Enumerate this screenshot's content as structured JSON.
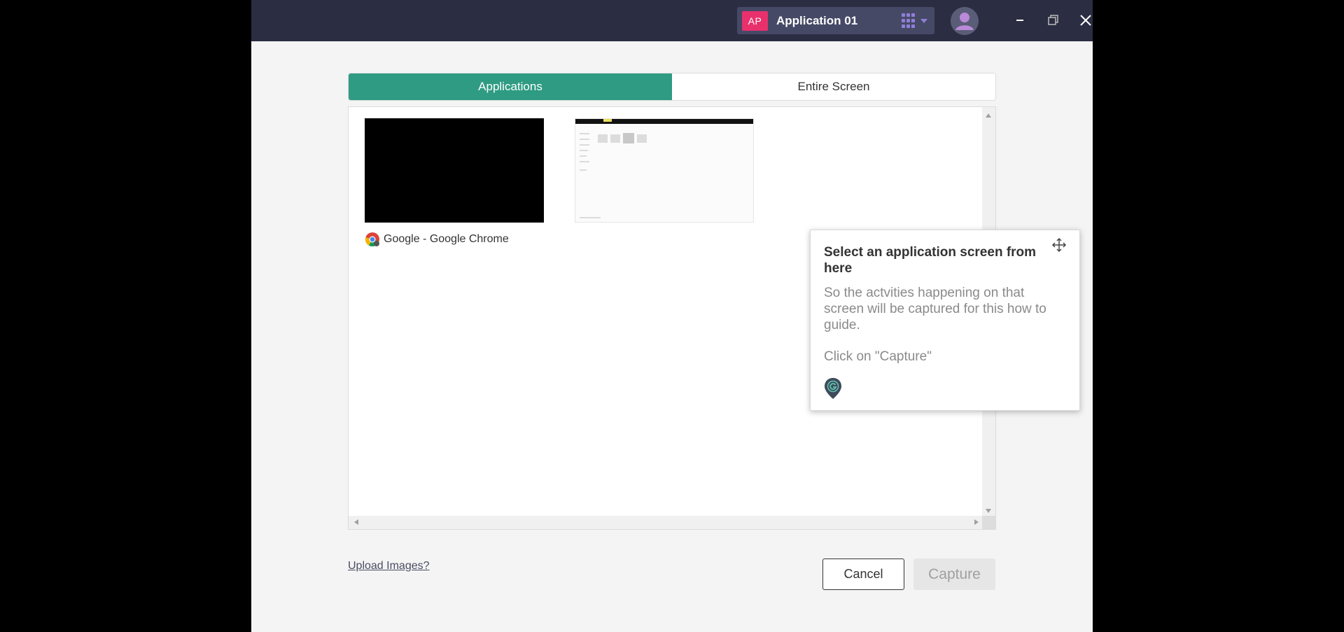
{
  "titlebar": {
    "app_badge": "AP",
    "app_name": "Application 01",
    "icons": [
      "apps-grid-icon",
      "chevron-down-icon",
      "user-avatar-icon",
      "minimize-icon",
      "restore-icon",
      "close-icon"
    ]
  },
  "tabs": [
    {
      "label": "Applications",
      "active": true
    },
    {
      "label": "Entire Screen",
      "active": false
    }
  ],
  "sources": [
    {
      "label": "Google - Google Chrome",
      "icon": "chrome-icon"
    },
    {
      "label": ""
    }
  ],
  "tooltip": {
    "title": "Select an application screen from here",
    "body": "So the actvities happening on that screen will be captured for this how to guide.",
    "cta": "Click on \"Capture\"",
    "icons": [
      "move-icon",
      "location-pin-icon"
    ]
  },
  "footer": {
    "upload_label": "Upload Images?",
    "cancel_label": "Cancel",
    "capture_label": "Capture"
  },
  "colors": {
    "titlebar_bg": "#2b2d42",
    "accent": "#2e9b82",
    "badge": "#e8316c",
    "grid_icon": "#8f7fd8"
  }
}
